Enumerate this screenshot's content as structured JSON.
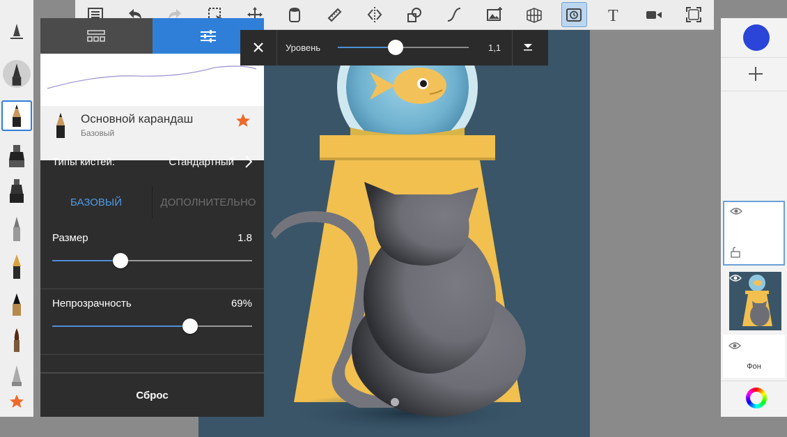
{
  "toolbar": {
    "icons": [
      "list-icon",
      "undo-icon",
      "redo-icon",
      "selection-icon",
      "transform-icon",
      "bucket-icon",
      "ruler-icon",
      "symmetry-icon",
      "shapes-icon",
      "curve-icon",
      "image-icon",
      "perspective-icon",
      "timelapse-icon",
      "text-icon",
      "video-icon",
      "fullscreen-icon"
    ],
    "active": "timelapse-icon"
  },
  "brush_panel": {
    "brush_name": "Основной карандаш",
    "brush_category": "Базовый",
    "brush_types_label": "Типы кистей:",
    "brush_types_value": "Стандартный",
    "tab_basic": "БАЗОВЫЙ",
    "tab_advanced": "ДОПОЛНИТЕЛЬНО",
    "size_label": "Размер",
    "size_value": "1.8",
    "size_fraction": 0.34,
    "opacity_label": "Непрозрачность",
    "opacity_value": "69%",
    "opacity_fraction": 0.69,
    "reset_label": "Сброс"
  },
  "level_bar": {
    "label": "Уровень",
    "value": "1,1",
    "fraction": 0.44
  },
  "layers": {
    "background_label": "Фон"
  },
  "colors": {
    "accent": "#2f7fd9",
    "current_color": "#2a45d8",
    "canvas_bg": "#3a5568",
    "star": "#ef6a2a"
  }
}
